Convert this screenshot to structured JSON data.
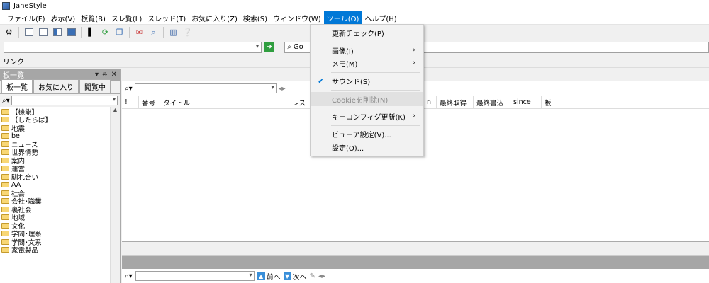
{
  "window": {
    "title": "JaneStyle"
  },
  "menubar": {
    "items": [
      "ファイル(F)",
      "表示(V)",
      "板覧(B)",
      "スレ覧(L)",
      "スレッド(T)",
      "お気に入り(Z)",
      "検索(S)",
      "ウィンドウ(W)",
      "ツール(O)",
      "ヘルプ(H)"
    ]
  },
  "address": {
    "value": ""
  },
  "google": {
    "label": "Go"
  },
  "linkbar": {
    "label": "リンク"
  },
  "left_pane": {
    "title": "板一覧",
    "controls": [
      "▾",
      "ᵰ",
      "✕"
    ],
    "tabs": [
      "板一覧",
      "お気に入り",
      "閲覧中"
    ],
    "tree": [
      "【機能】",
      "【したらば】",
      "地震",
      "be",
      "ニュース",
      "世界情勢",
      "案内",
      "運営",
      "馴れ合い",
      "AA",
      "社会",
      "会社･職業",
      "裏社会",
      "地域",
      "文化",
      "学問･理系",
      "学問･文系",
      "家電製品"
    ]
  },
  "thread_list": {
    "columns": [
      "!",
      "番号",
      "タイトル",
      "レス",
      "n",
      "最終取得",
      "最終書込",
      "since",
      "板"
    ]
  },
  "bottom_nav": {
    "prev": "前へ",
    "next": "次へ"
  },
  "tools_menu": {
    "items": [
      {
        "label": "更新チェック(P)"
      },
      {
        "label": "画像(I)",
        "submenu": true
      },
      {
        "label": "メモ(M)",
        "submenu": true
      },
      {
        "label": "サウンド(S)",
        "checked": true
      },
      {
        "label": "Cookieを削除(N)",
        "disabled": true
      },
      {
        "label": "キーコンフィグ更新(K)",
        "submenu": true
      },
      {
        "label": "ビューア設定(V)..."
      },
      {
        "label": "設定(O)..."
      }
    ]
  },
  "colors": {
    "accent": "#0078d7",
    "pane_header": "#a6a6a6"
  }
}
